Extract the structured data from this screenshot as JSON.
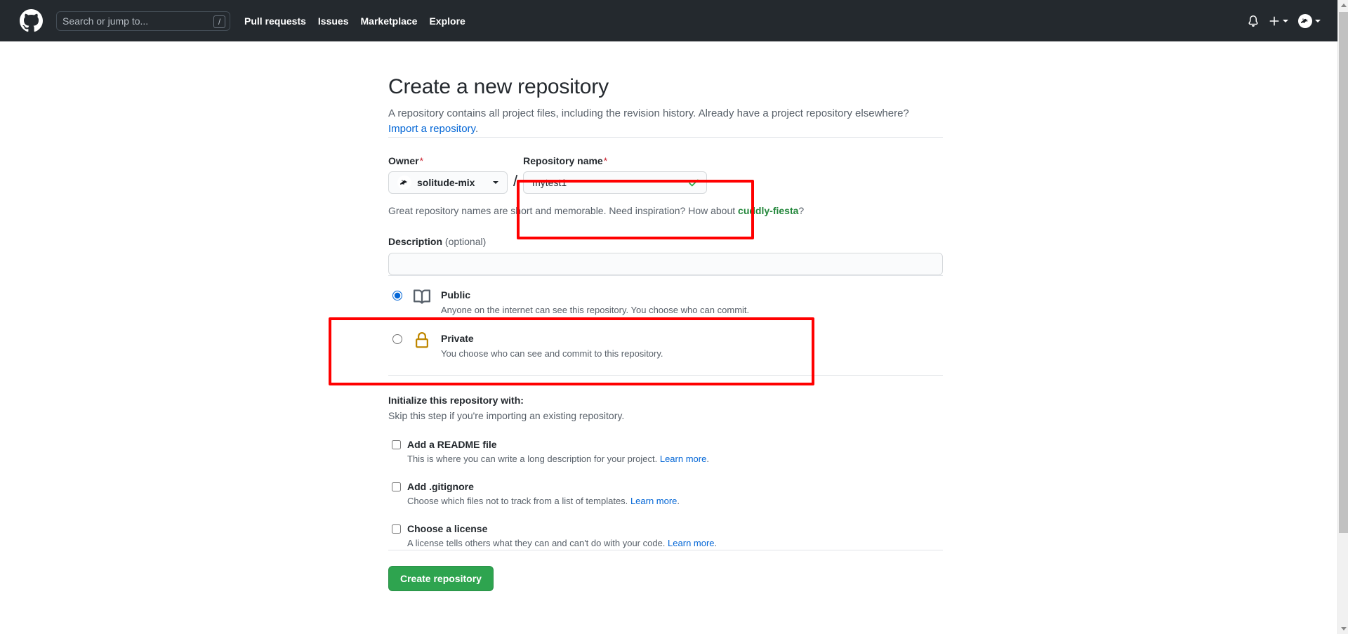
{
  "header": {
    "logo_icon": "github-mark-icon",
    "search": {
      "placeholder": "Search or jump to...",
      "shortcut_key": "/"
    },
    "nav": [
      {
        "label": "Pull requests"
      },
      {
        "label": "Issues"
      },
      {
        "label": "Marketplace"
      },
      {
        "label": "Explore"
      }
    ],
    "notifications_icon": "bell-icon",
    "create_new_icon": "plus-icon",
    "account_icon": "avatar-icon",
    "background_color": "#24292e"
  },
  "main": {
    "title": "Create a new repository",
    "subtitle_text": "A repository contains all project files, including the revision history. Already have a project repository elsewhere?",
    "import_link": "Import a repository",
    "import_link_suffix": ".",
    "owner": {
      "label": "Owner",
      "required_mark": "*",
      "selected": "solitude-mix",
      "avatar_icon": "owner-avatar-icon",
      "caret_icon": "chevron-down-icon"
    },
    "separator": "/",
    "repo_name": {
      "label": "Repository name",
      "required_mark": "*",
      "value": "mytest1",
      "placeholder": "",
      "valid_icon": "check-icon",
      "valid_color": "#28a745"
    },
    "name_hint_prefix": "Great repository names are short and memorable. Need inspiration? How about ",
    "name_hint_suggestion": "cuddly-fiesta",
    "name_hint_suffix": "?",
    "description": {
      "label": "Description",
      "optional_text": "(optional)",
      "value": "",
      "placeholder": ""
    },
    "visibility": [
      {
        "id": "public",
        "name": "Public",
        "description": "Anyone on the internet can see this repository. You choose who can commit.",
        "icon": "repo-book-icon",
        "selected": true
      },
      {
        "id": "private",
        "name": "Private",
        "description": "You choose who can see and commit to this repository.",
        "icon": "lock-icon",
        "selected": false
      }
    ],
    "initialize": {
      "title": "Initialize this repository with:",
      "subtitle": "Skip this step if you're importing an existing repository.",
      "options": [
        {
          "label": "Add a README file",
          "description": "This is where you can write a long description for your project.",
          "learn_more": "Learn more",
          "learn_more_suffix": ".",
          "checked": false
        },
        {
          "label": "Add .gitignore",
          "description": "Choose which files not to track from a list of templates.",
          "learn_more": "Learn more",
          "learn_more_suffix": ".",
          "checked": false
        },
        {
          "label": "Choose a license",
          "description": "A license tells others what they can and can't do with your code.",
          "learn_more": "Learn more",
          "learn_more_suffix": ".",
          "checked": false
        }
      ]
    },
    "submit_label": "Create repository",
    "submit_color": "#2ea44f"
  },
  "annotations": {
    "color": "#ff0000",
    "boxes": [
      {
        "name": "repository-name-highlight"
      },
      {
        "name": "public-visibility-highlight"
      }
    ]
  },
  "scrollbar": {
    "up_arrow_icon": "triangle-up-icon",
    "down_arrow_icon": "triangle-down-icon",
    "thumb": "scroll-thumb"
  }
}
